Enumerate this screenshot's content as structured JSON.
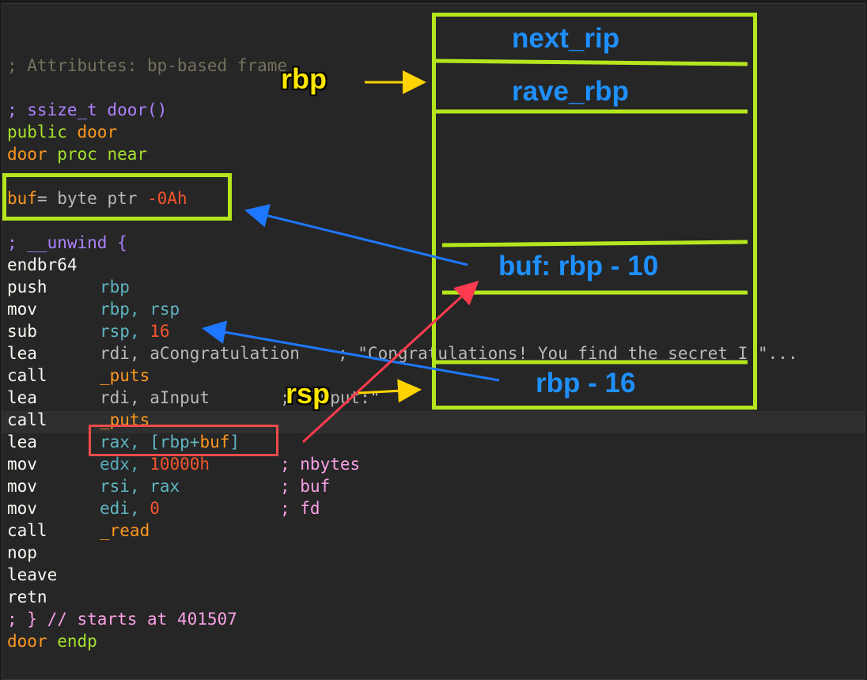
{
  "code": {
    "attributes_comment": "; Attributes: bp-based frame",
    "signature_comment": "; ssize_t door()",
    "public_kw": "public",
    "public_name": "door",
    "proc_name": "door",
    "proc_kw": "proc near",
    "buf_name": "buf",
    "buf_decl": "= byte ptr ",
    "buf_offset": "-0Ah",
    "unwind_open": "; __unwind {",
    "instructions": [
      {
        "op": "endbr64",
        "args": ""
      },
      {
        "op": "push",
        "args": "rbp"
      },
      {
        "op": "mov",
        "args": "rbp, rsp"
      },
      {
        "op": "sub",
        "args_reg": "rsp, ",
        "args_num": "16"
      },
      {
        "op": "lea",
        "args": "rdi, aCongratulation",
        "comment": "; \"Congratulations! You find the secret I \"..."
      },
      {
        "op": "call",
        "args": "_puts"
      },
      {
        "op": "lea",
        "args": "rdi, aInput",
        "comment": "; \"Input:\""
      },
      {
        "op": "call",
        "args": "_puts"
      },
      {
        "op": "lea",
        "args_reg": "rax, [rbp+",
        "args_var": "buf",
        "args_close": "]"
      },
      {
        "op": "mov",
        "args_reg": "edx, ",
        "args_num": "10000h",
        "comment": "; nbytes"
      },
      {
        "op": "mov",
        "args": "rsi, rax",
        "comment": "; buf"
      },
      {
        "op": "mov",
        "args_reg": "edi, ",
        "args_num": "0",
        "comment": "; fd"
      },
      {
        "op": "call",
        "args": "_read"
      },
      {
        "op": "nop",
        "args": ""
      },
      {
        "op": "leave",
        "args": ""
      },
      {
        "op": "retn",
        "args": ""
      }
    ],
    "unwind_close": "; } // starts at 401507",
    "endp_name": "door",
    "endp_kw": "endp"
  },
  "stack": {
    "slots": [
      "next_rip",
      "rave_rbp",
      "buf: rbp - 10",
      "rbp - 16"
    ]
  },
  "pointers": {
    "rbp": "rbp",
    "rsp": "rsp"
  },
  "colors": {
    "stack_border": "#b5e61d",
    "stack_label": "#1e90ff",
    "pointer_label": "#ffe600",
    "arrow_blue": "#1e78ff",
    "arrow_red": "#ff3b4f",
    "arrow_yellow": "#ffd400",
    "highlight_box": "#ef4b4b"
  }
}
